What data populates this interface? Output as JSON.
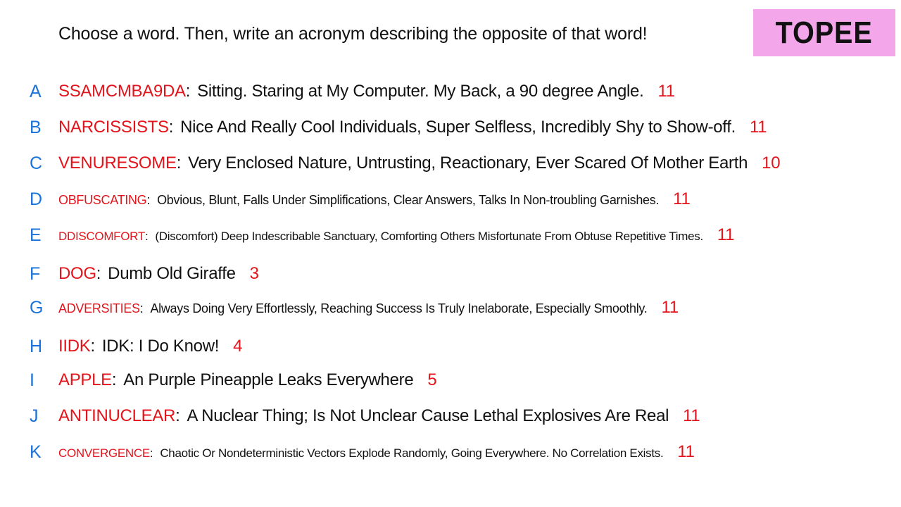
{
  "header": {
    "prompt": "Choose a word. Then, write an acronym describing the opposite of that word!",
    "badge": "TOPEE"
  },
  "entries": [
    {
      "letter": "A",
      "word": "SSAMCMBA9DA",
      "definition": "Sitting. Staring at My Computer. My Back, a 90 degree Angle.",
      "score": "11"
    },
    {
      "letter": "B",
      "word": "NARCISSISTS",
      "definition": "Nice And Really Cool Individuals, Super Selfless, Incredibly Shy to Show-off.",
      "score": "11"
    },
    {
      "letter": "C",
      "word": "VENURESOME",
      "definition": "Very Enclosed Nature, Untrusting, Reactionary, Ever Scared Of Mother Earth",
      "score": "10"
    },
    {
      "letter": "D",
      "word": "OBFUSCATING",
      "definition": "Obvious, Blunt, Falls Under Simplifications, Clear Answers, Talks In Non-troubling Garnishes.",
      "score": "11"
    },
    {
      "letter": "E",
      "word": "DDISCOMFORT",
      "definition": "(Discomfort) Deep Indescribable Sanctuary, Comforting Others Misfortunate From Obtuse Repetitive Times.",
      "score": "11"
    },
    {
      "letter": "F",
      "word": "DOG",
      "definition": "Dumb Old Giraffe",
      "score": "3"
    },
    {
      "letter": "G",
      "word": "ADVERSITIES",
      "definition": "Always Doing Very Effortlessly, Reaching Success Is Truly Inelaborate, Especially Smoothly.",
      "score": "11"
    },
    {
      "letter": "H",
      "word": "IIDK",
      "definition": "IDK: I Do Know!",
      "score": "4"
    },
    {
      "letter": "I",
      "word": "APPLE",
      "definition": "An Purple Pineapple Leaks Everywhere",
      "score": "5"
    },
    {
      "letter": "J",
      "word": "ANTINUCLEAR",
      "definition": "A Nuclear Thing; Is Not Unclear Cause Lethal Explosives Are Real",
      "score": "11"
    },
    {
      "letter": "K",
      "word": "CONVERGENCE",
      "definition": "Chaotic Or Nondeterministic Vectors Explode Randomly, Going Everywhere. No Correlation Exists.",
      "score": "11"
    }
  ],
  "colors": {
    "word": "#e3141b",
    "letter": "#1a73d9",
    "badge_bg": "#f4a6ea",
    "text": "#111111"
  }
}
